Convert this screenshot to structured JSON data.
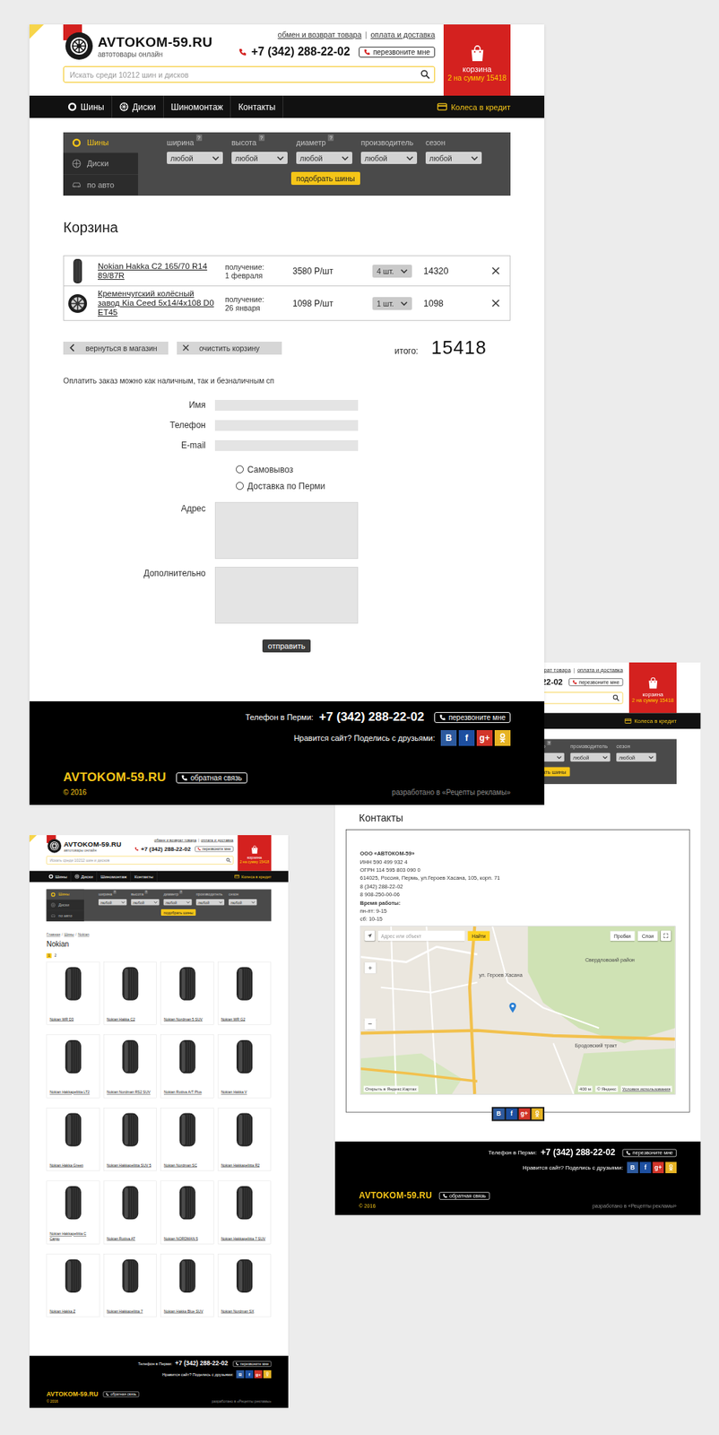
{
  "site": {
    "logo": "AVTOKOM-59.RU",
    "tagline": "автотовары онлайн",
    "top_links": [
      "обмен и возврат товара",
      "оплата и доставка"
    ],
    "link_separator": "|",
    "phone": "+7 (342) 288-22-02",
    "callback": "перезвоните мне",
    "search_placeholder": "Искать среди 10212 шин и дисков",
    "cart": {
      "label": "корзина",
      "summary": "2 на сумму 15418"
    },
    "nav": [
      {
        "label": "Шины",
        "kind": "tire"
      },
      {
        "label": "Диски",
        "kind": "disk"
      },
      {
        "label": "Шиномонтаж",
        "kind": "plain"
      },
      {
        "label": "Контакты",
        "kind": "plain"
      }
    ],
    "credit": "Колеса в кредит",
    "filter": {
      "tabs": [
        {
          "label": "Шины",
          "kind": "tire",
          "selected": true
        },
        {
          "label": "Диски",
          "kind": "disk",
          "selected": false
        },
        {
          "label": "по авто",
          "kind": "car",
          "selected": false
        }
      ],
      "fields": [
        {
          "label": "ширина",
          "hint": "?",
          "value": "любой"
        },
        {
          "label": "высота",
          "hint": "?",
          "value": "любой"
        },
        {
          "label": "диаметр",
          "hint": "?",
          "value": "любой"
        },
        {
          "label": "производитель",
          "value": "любой"
        },
        {
          "label": "сезон",
          "value": "любой"
        }
      ],
      "button": "подобрать шины"
    }
  },
  "footer": {
    "phone_label": "Телефон в Перми:",
    "share": "Нравится сайт? Поделись с друзьями:",
    "socials": [
      {
        "kind": "text",
        "label": "В",
        "color": "#2d5a9e"
      },
      {
        "kind": "text",
        "label": "f",
        "color": "#1d4fa0"
      },
      {
        "kind": "text",
        "label": "g+",
        "color": "#d2352a"
      },
      {
        "kind": "ok",
        "color": "#e6b323"
      }
    ],
    "feedback": "обратная связь",
    "year": "© 2016",
    "credit": "разработано в «Рецепты рекламы»"
  },
  "mockups": [
    {
      "kind": "contacts"
    },
    {
      "kind": "catalog"
    },
    {
      "kind": "cart"
    }
  ],
  "cart_page": {
    "title": "Корзина",
    "items": [
      {
        "kind": "tire",
        "name": "Nokian Hakka C2 165/70 R14 89/87R",
        "delivery_label": "получение:",
        "delivery_date": "1 февраля",
        "price": "3580 Р/шт",
        "qty": "4 шт.",
        "sum": "14320"
      },
      {
        "kind": "disk",
        "name": "Кременчугский колёсный завод Kia Ceed 5x14/4x108 D0 ET45",
        "delivery_label": "получение:",
        "delivery_date": "26 января",
        "price": "1098 Р/шт",
        "qty": "1 шт.",
        "sum": "1098"
      }
    ],
    "back": "вернуться в магазин",
    "clear": "очистить корзину",
    "total_label": "итого:",
    "total": "15418",
    "note": "Оплатить заказ можно как наличным, так и безналичным сп",
    "inputs": [
      {
        "label": "Имя"
      },
      {
        "label": "Телефон"
      },
      {
        "label": "E-mail"
      }
    ],
    "delivery_options": [
      {
        "label": "Самовывоз",
        "selected": false
      },
      {
        "label": "Доставка по Перми",
        "selected": false
      }
    ],
    "text_areas": [
      {
        "label": "Адрес"
      },
      {
        "label": "Дополнительно"
      }
    ],
    "submit": "отправить"
  },
  "contacts_page": {
    "title": "Контакты",
    "lines": [
      {
        "kind": "heading",
        "text": "ООО «АВТОКОМ-59»"
      },
      {
        "kind": "text",
        "text": "ИНН 590 499 932 4"
      },
      {
        "kind": "text",
        "text": "ОГРН 114 595 803 090 0"
      },
      {
        "kind": "text",
        "text": "614025, Россия, Пермь, ул.Героев Хасана, 105, корп. 71"
      },
      {
        "kind": "text",
        "text": "8 (342) 288-22-02"
      },
      {
        "kind": "text",
        "text": "8 908-250-00-06"
      },
      {
        "kind": "heading",
        "text": "Время работы:"
      },
      {
        "kind": "text",
        "text": "пн-пт: 9-15"
      },
      {
        "kind": "text",
        "text": "сб: 10-15"
      }
    ],
    "map": {
      "search_placeholder": "Адрес или объект",
      "search_button": "Найти",
      "traffic": "Пробки",
      "layers": "Слои",
      "zoom_in": "+",
      "zoom_out": "−",
      "labels": [
        {
          "text": "Свердловский район"
        },
        {
          "text": "Бродовский тракт"
        },
        {
          "text": "ул. Героев Хасана"
        }
      ],
      "scale": "400 м",
      "open_link": "Открыть в Яндекс.Картах",
      "copyright": "© Яндекс",
      "terms": "Условия использования"
    }
  },
  "catalog_page": {
    "breadcrumbs": [
      {
        "label": "Главная"
      },
      {
        "label": "Шины"
      },
      {
        "label": "Nokian"
      }
    ],
    "separator": "/",
    "title": "Nokian",
    "pages": [
      {
        "label": "1",
        "selected": true
      },
      {
        "label": "2",
        "selected": false
      }
    ],
    "products": [
      {
        "name": "Nokian WR D3"
      },
      {
        "name": "Nokian Hakka C2"
      },
      {
        "name": "Nokian Nordman 5 SUV"
      },
      {
        "name": "Nokian WR G2"
      },
      {
        "name": "Nokian Hakkapeliitta LT2"
      },
      {
        "name": "Nokian Nordman RS2 SUV"
      },
      {
        "name": "Nokian Rotiiva A/T Plus"
      },
      {
        "name": "Nokian Hakka V"
      },
      {
        "name": "Nokian Hakka Green"
      },
      {
        "name": "Nokian Hakkapeliitta SUV 5"
      },
      {
        "name": "Nokian Nordman SC"
      },
      {
        "name": "Nokian Hakkapeliitta R2"
      },
      {
        "name": "Nokian Hakkapeliitta C Cargo"
      },
      {
        "name": "Nokian Rotiiva AT"
      },
      {
        "name": "Nokian NORDMAN 5"
      },
      {
        "name": "Nokian Hakkapeliitta 7 SUV"
      },
      {
        "name": "Nokian Hakka Z"
      },
      {
        "name": "Nokian Hakkapeliitta 7"
      },
      {
        "name": "Nokian Hakka Blue SUV"
      },
      {
        "name": "Nokian Nordman SX"
      }
    ]
  }
}
